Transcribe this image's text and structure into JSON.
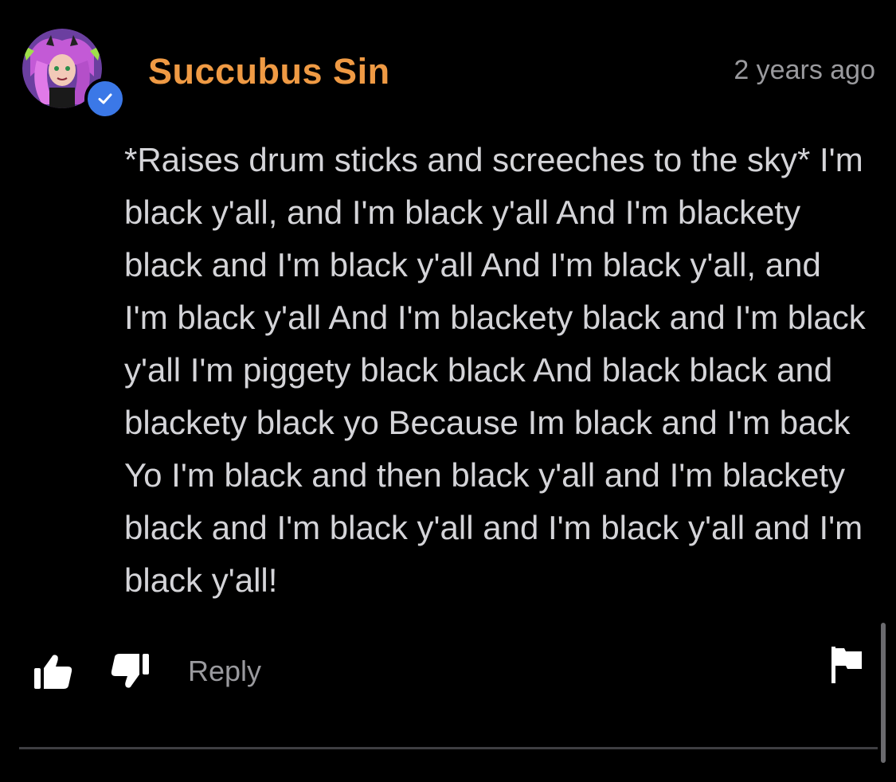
{
  "comment": {
    "author": "Succubus Sin",
    "timestamp": "2 years ago",
    "text": "*Raises drum sticks and screeches to the sky* I'm black y'all, and I'm black y'all And I'm blackety black and I'm black y'all And I'm black y'all, and I'm black y'all And I'm blackety black and I'm black y'all I'm piggety black black And black black and blackety black yo Because Im black and I'm back Yo I'm black and then black y'all and I'm blackety black and I'm black y'all and I'm black y'all and I'm black y'all!",
    "verified": true
  },
  "actions": {
    "reply_label": "Reply",
    "like_icon": "thumbs-up-icon",
    "dislike_icon": "thumbs-down-icon",
    "report_icon": "flag-icon"
  },
  "colors": {
    "background": "#000000",
    "author": "#ef9a44",
    "text": "#d4d4d8",
    "muted": "#9a9a9e",
    "verified_badge": "#3b78e7"
  }
}
